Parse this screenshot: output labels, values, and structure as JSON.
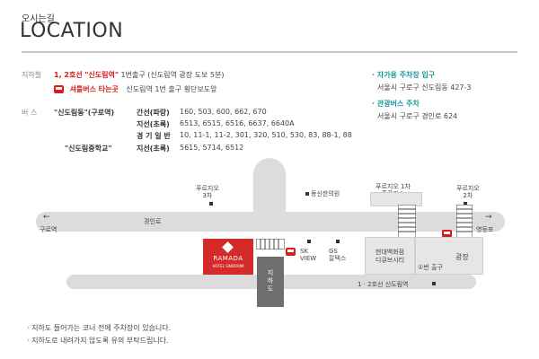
{
  "header": {
    "subtitle": "오시는길",
    "title": "LOCATION"
  },
  "subway": {
    "label": "지하철",
    "line": "1, 2호선",
    "station": "\"신도림역\"",
    "exit_detail": " 1번출구 (신도림역 광장 도보 5분)"
  },
  "shuttle": {
    "label": "셔틀버스 타는곳",
    "detail": "신도림역 1번 출구 횡단보도앞"
  },
  "bus": {
    "label": "버  스",
    "stop1": "\"신도림동\"(구로역)",
    "rows1": [
      {
        "type": "간선(파랑)",
        "nums": "160, 503, 600, 662, 670"
      },
      {
        "type": "지선(초록)",
        "nums": "6513, 6515, 6516, 6637, 6640A"
      },
      {
        "type": "경 기 일 반",
        "nums": "10, 11-1, 11-2, 301, 320, 510, 530, 83, 88-1, 88"
      }
    ],
    "stop2": "\"신도림중학교\"",
    "rows2": [
      {
        "type": "지선(초록)",
        "nums": "5615, 5714, 6512"
      }
    ]
  },
  "parking": {
    "self_label": "자가용 주차장 입구",
    "self_addr": "서울시 구로구 신도림동 427-3",
    "tour_label": "관광버스 주차",
    "tour_addr": "서울시 구로구 경인로 624"
  },
  "map": {
    "left_arrow": "←",
    "left_dest": "구로역",
    "right_arrow": "→",
    "right_dest": "영등포",
    "road_name": "경인로",
    "purgio3": "푸르지오\n3차",
    "purgio1": "푸르지오 1차\n홈플러스",
    "purgio2": "푸르지오\n2차",
    "clinic": "동신한의원",
    "hotel_logo": "RAMADA",
    "hotel_sub": "HOTEL SINDORIM",
    "sk": "SK\nVIEW",
    "gs": "GS\n칼텍스",
    "dept": "현대백화점\n디큐브시티",
    "exit1": "①번 출구",
    "plaza": "광장",
    "underpass": "지\n하\n도",
    "station_label": "1 · 2호선 신도림역"
  },
  "notes": [
    "· 지하도 들어가는 코너 전에 주차장이 있습니다.",
    "· 지하도로 내려가지 않도록 유의 부탁드립니다."
  ],
  "colors": {
    "accent_red": "#d91c1c",
    "teal": "#1a9aa0",
    "road": "#dcdcdc",
    "hotel_red": "#d42a2a"
  }
}
